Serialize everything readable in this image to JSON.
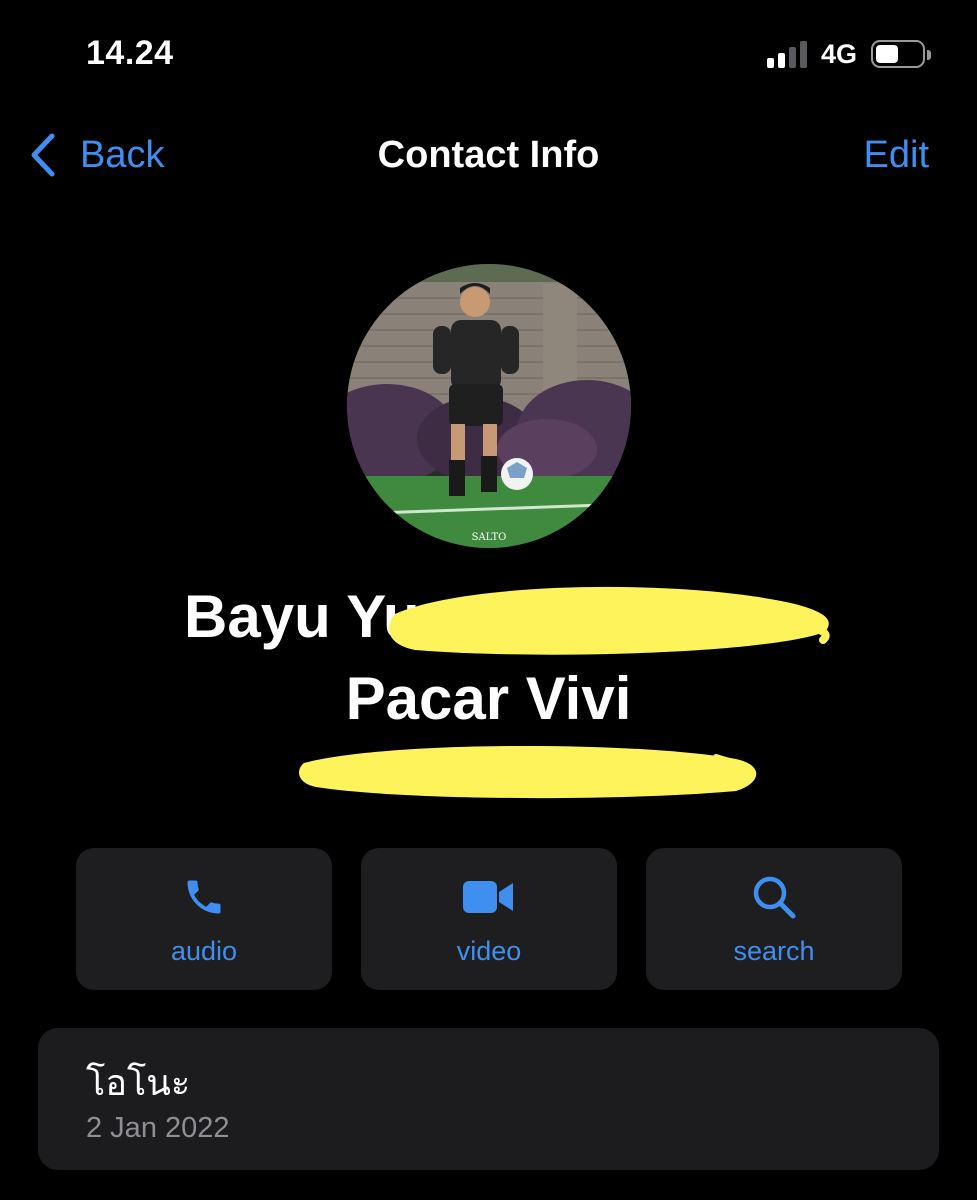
{
  "status_bar": {
    "time": "14.24",
    "network": "4G",
    "signal_bars_active": 2,
    "signal_bars_total": 4,
    "battery_level": 0.5
  },
  "nav": {
    "back_label": "Back",
    "title": "Contact Info",
    "edit_label": "Edit"
  },
  "avatar": {
    "watermark": "SALTO"
  },
  "contact": {
    "name_visible": "Bayu Yu",
    "name_line2": "Pacar Vivi"
  },
  "actions": [
    {
      "label": "audio",
      "icon": "phone-icon"
    },
    {
      "label": "video",
      "icon": "video-camera-icon"
    },
    {
      "label": "search",
      "icon": "magnifier-icon"
    }
  ],
  "about": {
    "text": "โอโนะ",
    "date": "2 Jan 2022"
  },
  "colors": {
    "background": "#000000",
    "accent": "#3e8ff0",
    "card": "#1c1c1e",
    "redaction": "#fff35c",
    "secondary_text": "#8e8e93"
  }
}
